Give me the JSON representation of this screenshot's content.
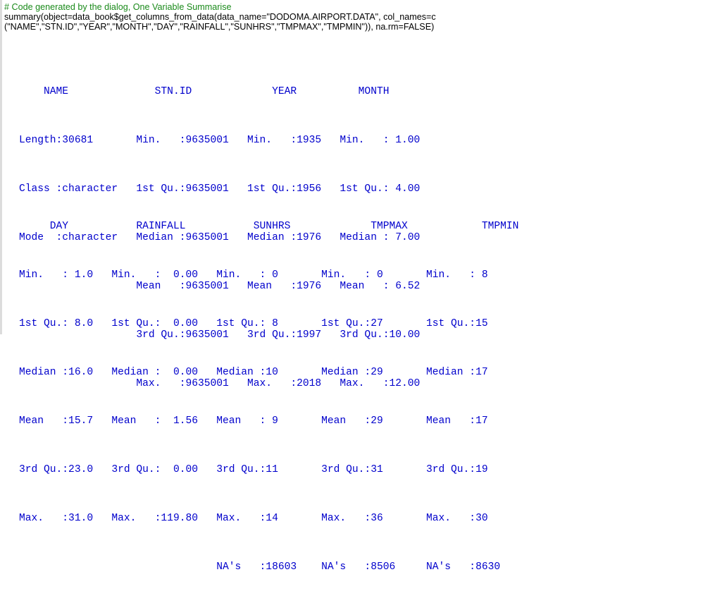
{
  "code_comment": "# Code generated by the dialog, One Variable Summarise",
  "command_line1": "summary(object=data_book$get_columns_from_data(data_name=\"DODOMA.AIRPORT.DATA\", col_names=c",
  "command_line2": "(\"NAME\",\"STN.ID\",\"YEAR\",\"MONTH\",\"DAY\",\"RAINFALL\",\"SUNHRS\",\"TMPMAX\",\"TMPMIN\")), na.rm=FALSE)",
  "summary_block1": [
    "    NAME              STN.ID             YEAR          MONTH      ",
    "Length:30681       Min.   :9635001   Min.   :1935   Min.   : 1.00  ",
    "Class :character   1st Qu.:9635001   1st Qu.:1956   1st Qu.: 4.00  ",
    "Mode  :character   Median :9635001   Median :1976   Median : 7.00  ",
    "                   Mean   :9635001   Mean   :1976   Mean   : 6.52  ",
    "                   3rd Qu.:9635001   3rd Qu.:1997   3rd Qu.:10.00  ",
    "                   Max.   :9635001   Max.   :2018   Max.   :12.00  "
  ],
  "summary_block2": [
    "     DAY           RAINFALL           SUNHRS             TMPMAX            TMPMIN     ",
    "Min.   : 1.0   Min.   :  0.00   Min.   : 0       Min.   : 0       Min.   : 8     ",
    "1st Qu.: 8.0   1st Qu.:  0.00   1st Qu.: 8       1st Qu.:27       1st Qu.:15     ",
    "Median :16.0   Median :  0.00   Median :10       Median :29       Median :17     ",
    "Mean   :15.7   Mean   :  1.56   Mean   : 9       Mean   :29       Mean   :17     ",
    "3rd Qu.:23.0   3rd Qu.:  0.00   3rd Qu.:11       3rd Qu.:31       3rd Qu.:19     ",
    "Max.   :31.0   Max.   :119.80   Max.   :14       Max.   :36       Max.   :30     ",
    "                                NA's   :18603    NA's   :8506     NA's   :8630   "
  ]
}
